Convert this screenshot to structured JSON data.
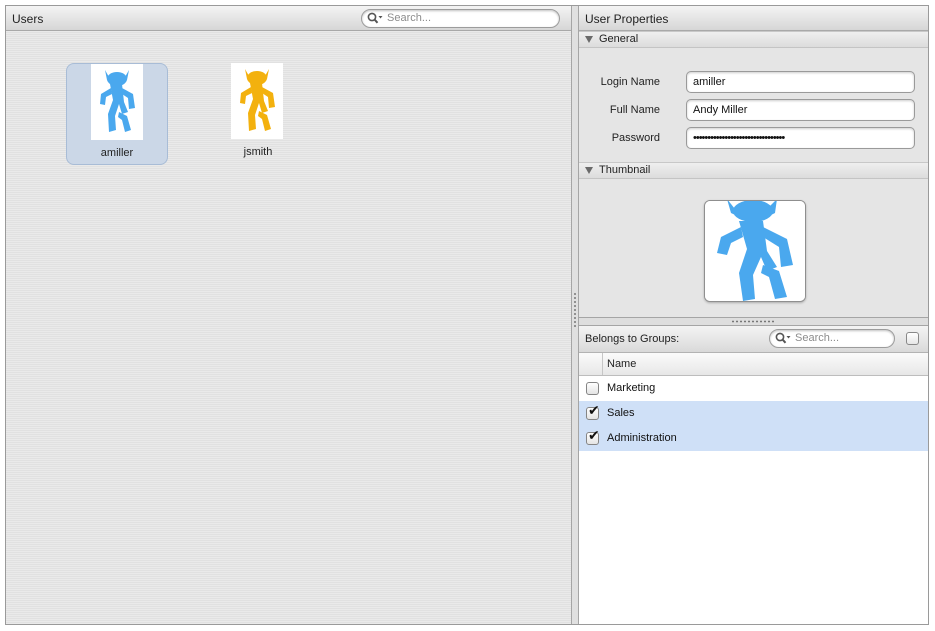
{
  "users_pane": {
    "title": "Users",
    "search_placeholder": "Search...",
    "users": [
      {
        "name": "amiller",
        "color": "#4aa8ee",
        "selected": true
      },
      {
        "name": "jsmith",
        "color": "#f3b10e",
        "selected": false
      }
    ]
  },
  "properties_pane": {
    "title": "User Properties",
    "general_section": "General",
    "fields": {
      "login_label": "Login Name",
      "login_value": "amiller",
      "fullname_label": "Full Name",
      "fullname_value": "Andy Miller",
      "password_label": "Password",
      "password_value": "••••••••••••••••••••••••••••••••"
    },
    "thumbnail_section": "Thumbnail",
    "thumbnail_color": "#4aa8ee"
  },
  "groups": {
    "title": "Belongs to Groups:",
    "search_placeholder": "Search...",
    "column_name": "Name",
    "items": [
      {
        "name": "Marketing",
        "checked": false
      },
      {
        "name": "Sales",
        "checked": true
      },
      {
        "name": "Administration",
        "checked": true
      }
    ]
  }
}
